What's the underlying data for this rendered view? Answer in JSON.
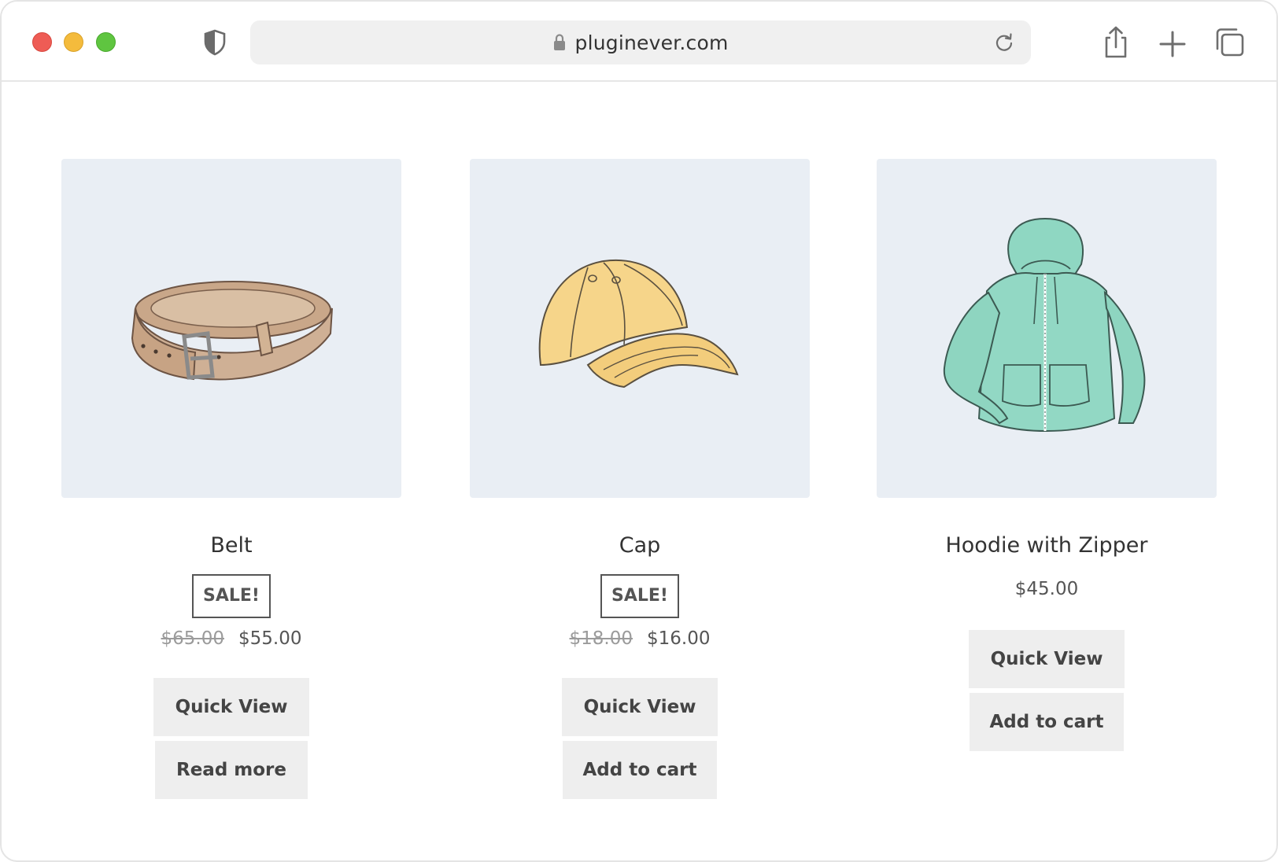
{
  "browser": {
    "url": "pluginever.com",
    "icons": {
      "privacy": "shield-icon",
      "lock": "lock-icon",
      "reload": "reload-icon",
      "share": "share-icon",
      "new_tab": "plus-icon",
      "tab_overview": "tabs-icon"
    },
    "traffic_lights": [
      "#ee5c55",
      "#f4bb3c",
      "#5fc540"
    ]
  },
  "products": [
    {
      "name": "Belt",
      "image": "belt-illustration",
      "on_sale": true,
      "sale_badge": "SALE!",
      "old_price": "$65.00",
      "price": "$55.00",
      "buttons": [
        "Quick View",
        "Read more"
      ]
    },
    {
      "name": "Cap",
      "image": "cap-illustration",
      "on_sale": true,
      "sale_badge": "SALE!",
      "old_price": "$18.00",
      "price": "$16.00",
      "buttons": [
        "Quick View",
        "Add to cart"
      ]
    },
    {
      "name": "Hoodie with Zipper",
      "image": "hoodie-illustration",
      "on_sale": false,
      "price": "$45.00",
      "buttons": [
        "Quick View",
        "Add to cart"
      ]
    }
  ],
  "colors": {
    "image_background": "#e9eef4",
    "button_background": "#eeeeee",
    "text": "#3a3a3a"
  }
}
